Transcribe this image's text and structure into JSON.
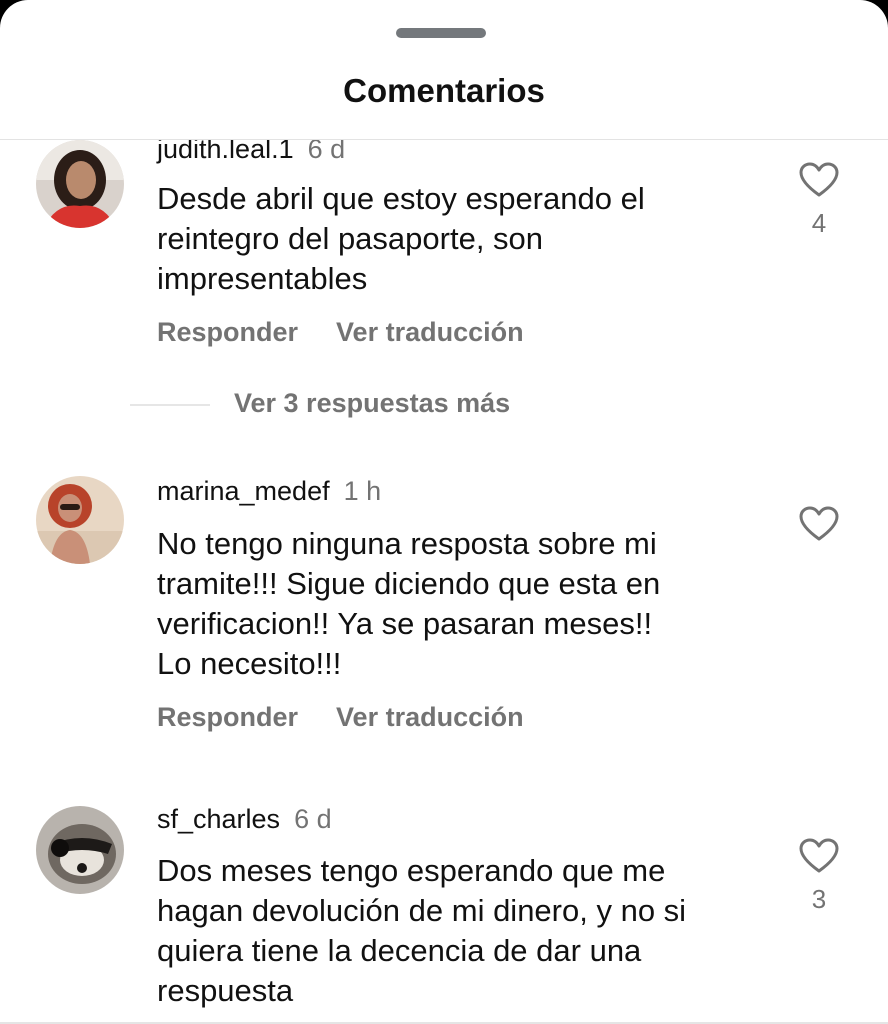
{
  "header": {
    "title": "Comentarios"
  },
  "comments": [
    {
      "username": "judith.leal.1",
      "time": "6 d",
      "text_lines": [
        "Desde abril que estoy esperando el",
        "reintegro del pasaporte, son",
        "impresentables"
      ],
      "reply_label": "Responder",
      "translate_label": "Ver traducción",
      "likes": "4",
      "more_replies_label": "Ver 3 respuestas más"
    },
    {
      "username": "marina_medef",
      "time": "1 h",
      "text_lines": [
        "No tengo ninguna resposta sobre mi",
        "tramite!!! Sigue diciendo que esta en",
        "verificacion!! Ya se pasaran meses!!",
        "Lo necesito!!!"
      ],
      "reply_label": "Responder",
      "translate_label": "Ver traducción",
      "likes": ""
    },
    {
      "username": "sf_charles",
      "time": "6 d",
      "text_lines": [
        "Dos meses tengo esperando que me",
        "hagan devolución de mi dinero, y no si",
        "quiera tiene la decencia de dar una",
        "respuesta"
      ],
      "likes": "3"
    }
  ],
  "icons": {
    "like": "heart-outline-icon"
  },
  "colors": {
    "text": "#111111",
    "muted": "#737373",
    "background": "#ffffff"
  }
}
